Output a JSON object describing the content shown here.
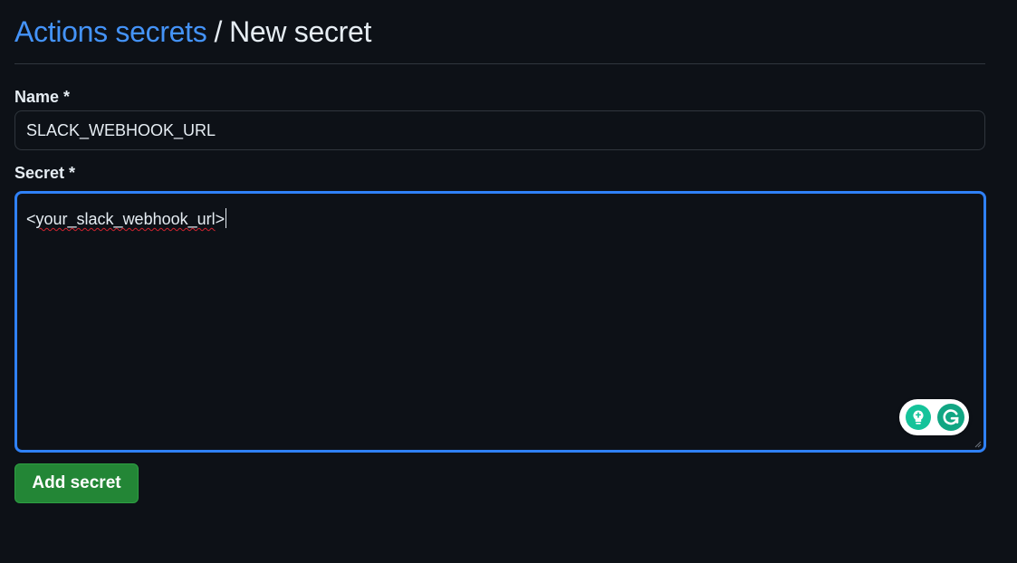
{
  "breadcrumb": {
    "link": "Actions secrets",
    "separator": "/",
    "current": "New secret"
  },
  "form": {
    "name_label": "Name *",
    "name_value": "SLACK_WEBHOOK_URL",
    "secret_label": "Secret *",
    "secret_value_prefix": "<",
    "secret_value_main": "your_slack_webhook_url",
    "secret_value_suffix": ">",
    "submit_label": "Add secret"
  },
  "overlays": {
    "grammarly": {
      "icons": [
        "lightbulb-icon",
        "grammarly-icon"
      ]
    }
  },
  "colors": {
    "background": "#0d1117",
    "link": "#4493f8",
    "focus_border": "#2f81f7",
    "primary_button": "#238636",
    "spellcheck_underline": "#d1242f",
    "grammarly_green": "#15c39a"
  }
}
